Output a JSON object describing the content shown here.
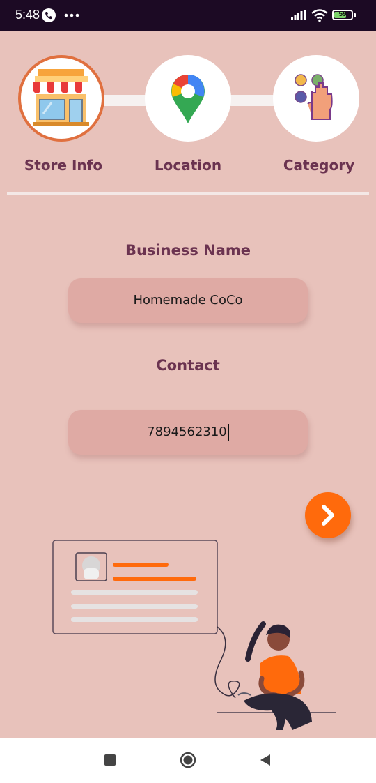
{
  "status_bar": {
    "time": "5:48",
    "battery": "59",
    "icons": [
      "call-icon",
      "more-dots-icon",
      "signal-icon",
      "wifi-icon",
      "battery-icon"
    ]
  },
  "stepper": {
    "steps": [
      {
        "label": "Store Info",
        "icon": "store-icon",
        "active": true
      },
      {
        "label": "Location",
        "icon": "map-pin-icon",
        "active": false
      },
      {
        "label": "Category",
        "icon": "category-hand-icon",
        "active": false
      }
    ]
  },
  "form": {
    "business_name": {
      "label": "Business Name",
      "value": "Homemade CoCo"
    },
    "contact": {
      "label": "Contact",
      "value": "7894562310"
    }
  },
  "next_button": {
    "icon": "chevron-right-icon"
  },
  "nav_bar": {
    "icons": [
      "recent-apps-icon",
      "home-icon",
      "back-icon"
    ]
  },
  "colors": {
    "background": "#e8c2bb",
    "status_bar": "#1c0a24",
    "accent": "#ff6a0c",
    "label": "#6b3350",
    "field": "#dfaaa4"
  }
}
